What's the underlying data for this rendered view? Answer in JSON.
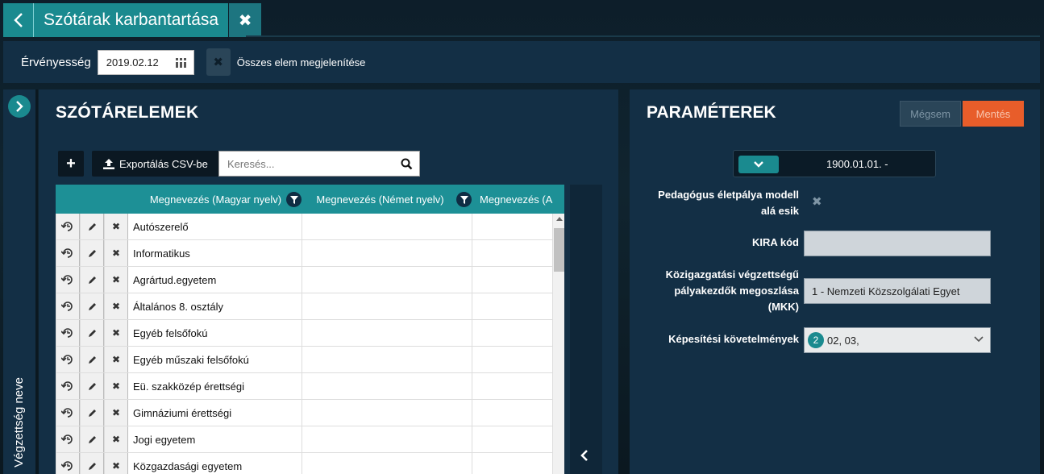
{
  "title": "Szótárak karbantartása",
  "filter": {
    "label": "Érvényesség",
    "date": "2019.02.12",
    "show_all_label": "Összes elem megjelenítése"
  },
  "sidebar": {
    "label": "Végzettség neve"
  },
  "left": {
    "title": "SZÓTÁRELEMEK",
    "add_label": "+",
    "export_label": "Exportálás CSV-be",
    "search_placeholder": "Keresés...",
    "columns": [
      "Megnevezés (Magyar nyelv)",
      "Megnevezés (Német nyelv)",
      "Megnevezés (A"
    ],
    "rows": [
      "Autószerelő",
      "Informatikus",
      "Agrártud.egyetem",
      "Általános 8. osztály",
      "Egyéb felsőfokú",
      "Egyéb műszaki felsőfokú",
      "Eü. szakközép érettségi",
      "Gimnáziumi érettségi",
      "Jogi egyetem",
      "Közgazdasági egyetem"
    ]
  },
  "right": {
    "title": "PARAMÉTEREK",
    "cancel_label": "Mégsem",
    "save_label": "Mentés",
    "period": "1900.01.01. -",
    "fields": {
      "pedagogus_label_1": "Pedagógus életpálya modell",
      "pedagogus_label_2": "alá esik",
      "kira_label": "KIRA kód",
      "kira_value": "",
      "mkk_label_1": "Közigazgatási végzettségű",
      "mkk_label_2": "pályakezdők megoszlása",
      "mkk_label_3": "(MKK)",
      "mkk_value": "1 - Nemzeti Közszolgálati Egyet",
      "kepesitesi_label": "Képesítési követelmények",
      "kepesitesi_count": "2",
      "kepesitesi_value": "02, 03,"
    }
  },
  "colors": {
    "teal": "#1a8a8f",
    "panel": "#132f45",
    "save": "#e85d2a"
  }
}
